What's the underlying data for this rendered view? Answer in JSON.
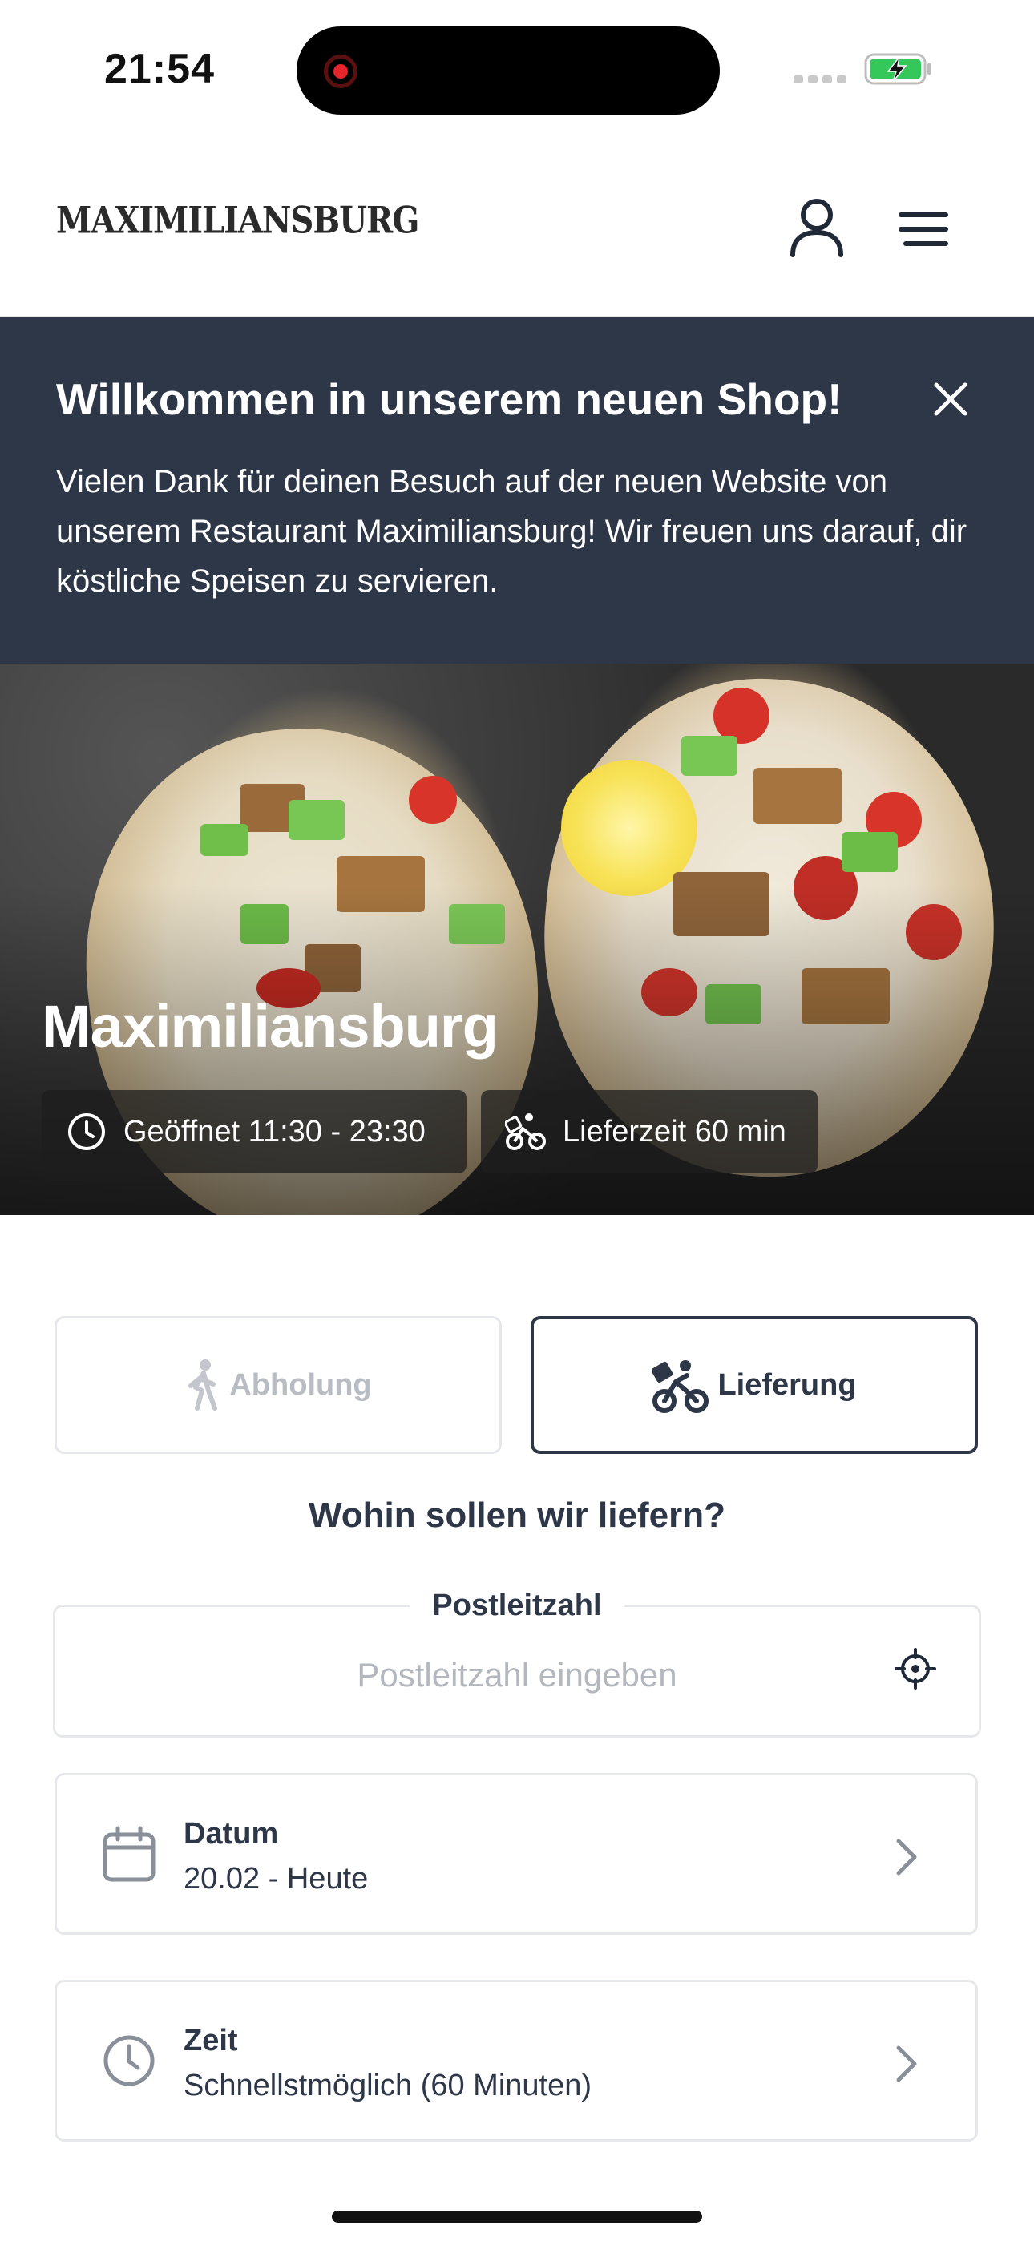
{
  "status_bar": {
    "time": "21:54"
  },
  "header": {
    "logo_text": "MAXIMILIANSBURG",
    "account_icon": "user-icon",
    "menu_icon": "hamburger-menu-icon"
  },
  "banner": {
    "title": "Willkommen in unserem neuen Shop!",
    "text": "Vielen Dank für deinen Besuch auf der neuen Website von unserem Restaurant Maximiliansburg! Wir freuen uns darauf, dir köstliche Speisen zu servieren.",
    "close_icon": "close-icon",
    "background": "#2d3748"
  },
  "hero": {
    "title": "Maximiliansburg",
    "opening_hours": "Geöffnet 11:30 - 23:30",
    "delivery_time": "Lieferzeit 60 min"
  },
  "order_mode": {
    "pickup_label": "Abholung",
    "delivery_label": "Lieferung",
    "selected": "delivery"
  },
  "delivery_form": {
    "question": "Wohin sollen wir liefern?",
    "postcode_label": "Postleitzahl",
    "postcode_placeholder": "Postleitzahl eingeben",
    "postcode_value": ""
  },
  "date_option": {
    "title": "Datum",
    "value": "20.02 - Heute"
  },
  "time_option": {
    "title": "Zeit",
    "value": "Schnellstmöglich (60 Minuten)"
  },
  "colors": {
    "primary_dark": "#2d3748",
    "border": "#e5e7eb",
    "muted": "#b8bcc3",
    "battery_green": "#34c759"
  }
}
